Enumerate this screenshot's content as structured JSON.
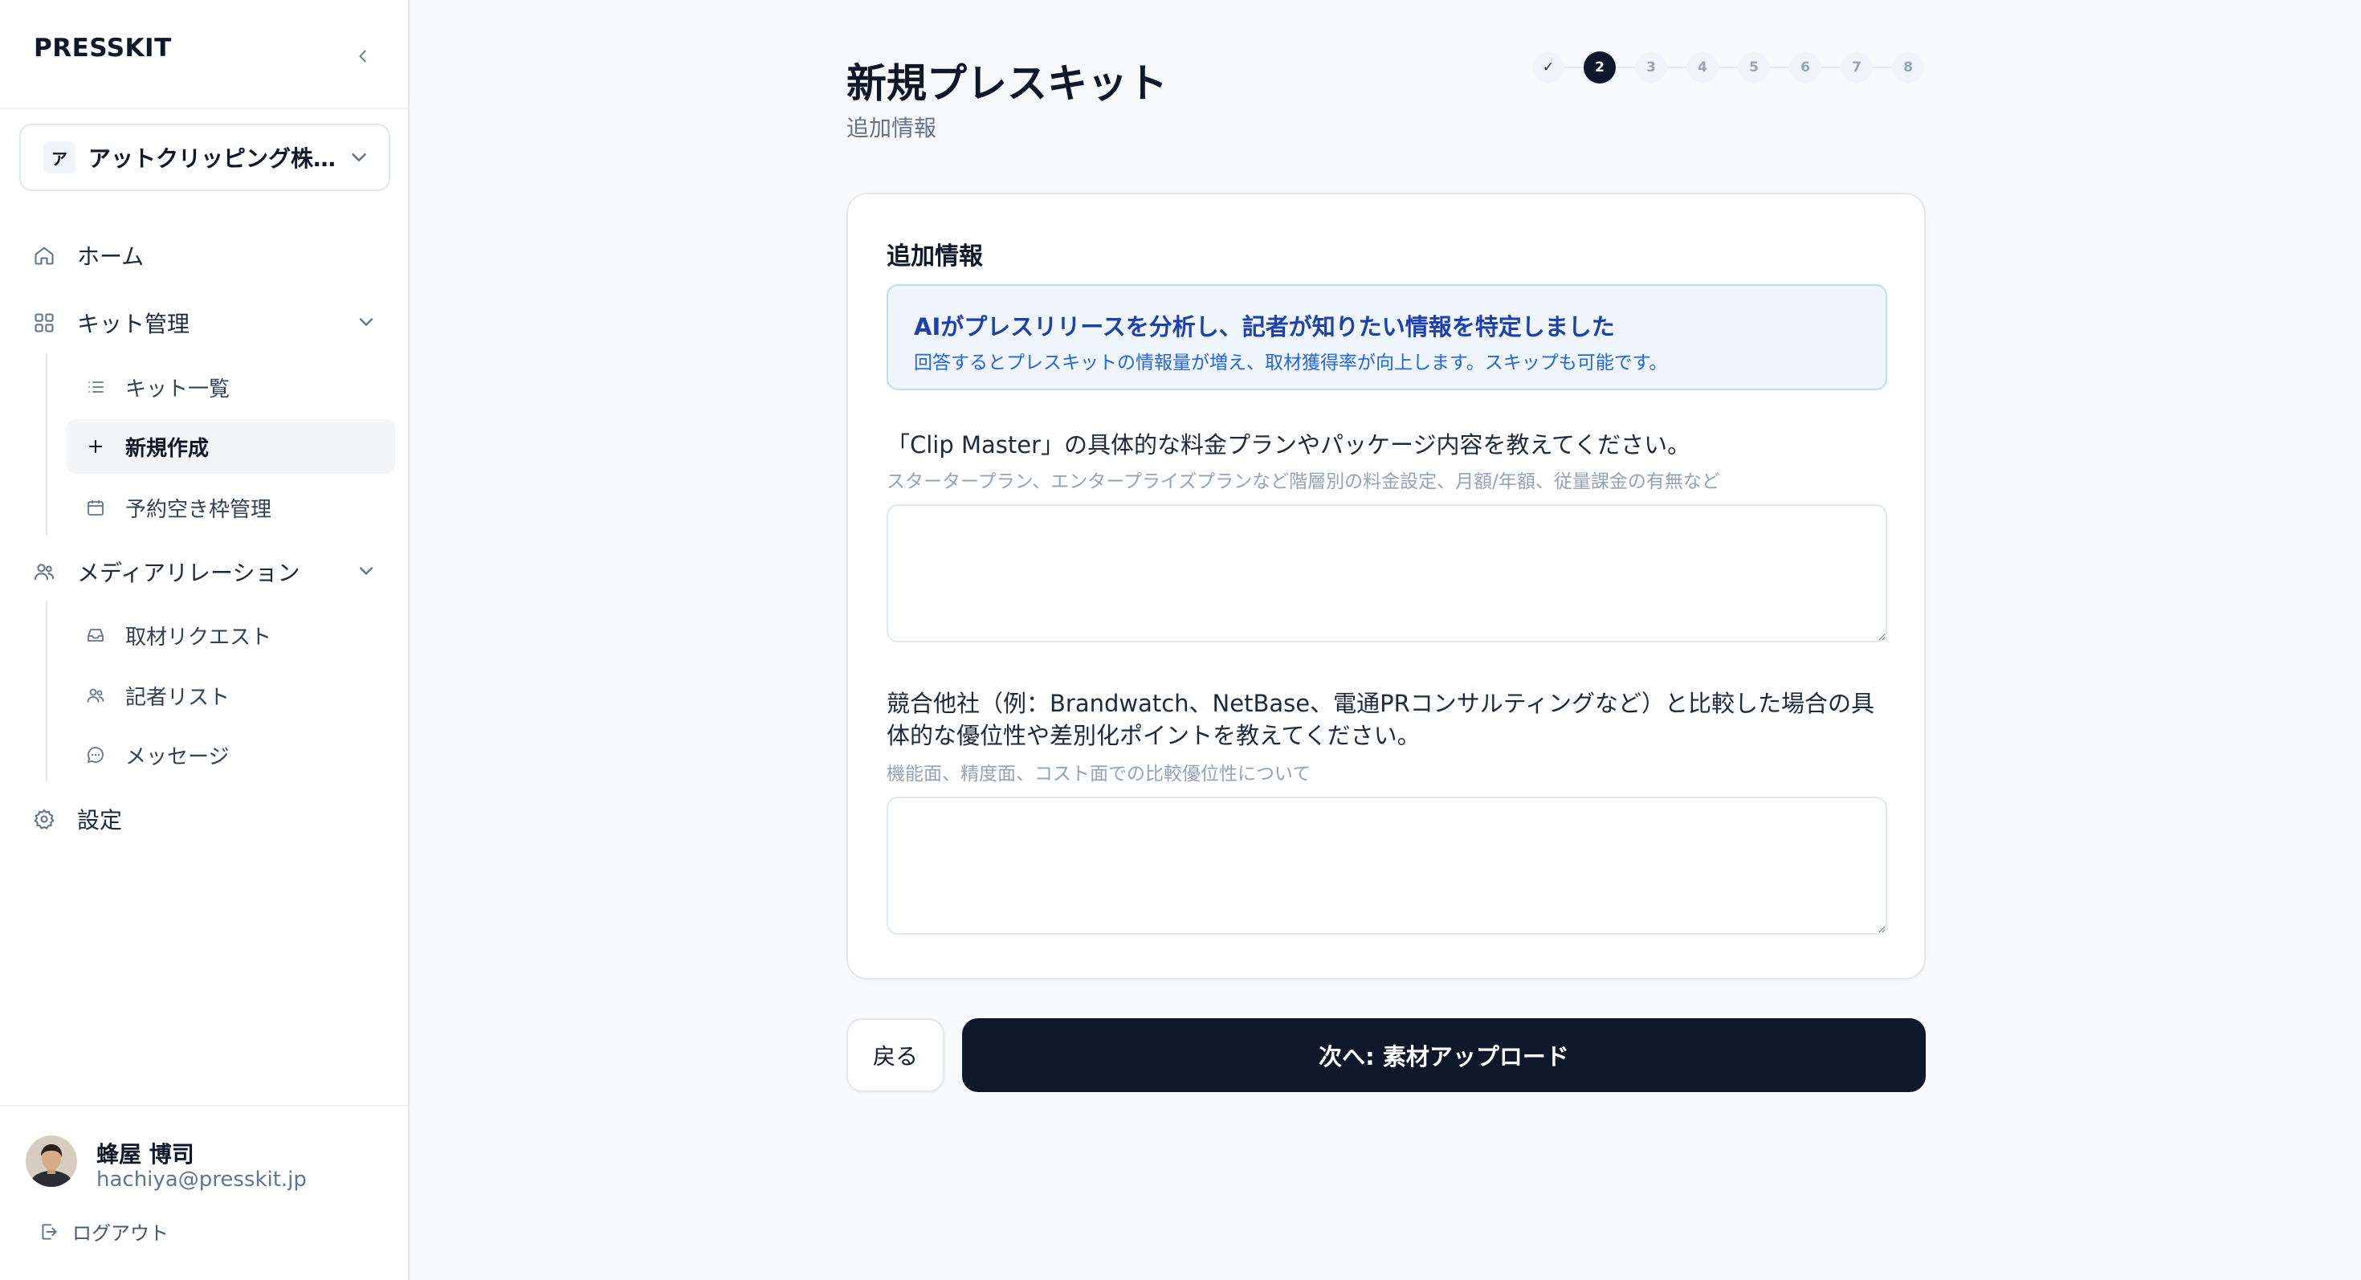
{
  "brand": {
    "logo": "PRESSKIT"
  },
  "org": {
    "avatar_letter": "ア",
    "name": "アットクリッピング株式会社"
  },
  "sidebar": {
    "home": "ホーム",
    "kit_management": "キット管理",
    "kit_list": "キット一覧",
    "new_create": "新規作成",
    "reservation": "予約空き枠管理",
    "media_relations": "メディアリレーション",
    "interview_requests": "取材リクエスト",
    "reporter_list": "記者リスト",
    "messages": "メッセージ",
    "settings": "設定"
  },
  "user": {
    "name": "蜂屋 博司",
    "email": "hachiya@presskit.jp",
    "logout": "ログアウト"
  },
  "header": {
    "title": "新規プレスキット",
    "subtitle": "追加情報"
  },
  "stepper": {
    "done_mark": "✓",
    "current": 2,
    "steps": [
      "2",
      "3",
      "4",
      "5",
      "6",
      "7",
      "8"
    ]
  },
  "card": {
    "title": "追加情報",
    "notice_heading": "AIがプレスリリースを分析し、記者が知りたい情報を特定しました",
    "notice_body": "回答するとプレスキットの情報量が増え、取材獲得率が向上します。スキップも可能です。",
    "questions": [
      {
        "label": "「Clip Master」の具体的な料金プランやパッケージ内容を教えてください。",
        "hint": "スタータープラン、エンタープライズプランなど階層別の料金設定、月額/年額、従量課金の有無など",
        "value": ""
      },
      {
        "label": "競合他社（例：Brandwatch、NetBase、電通PRコンサルティングなど）と比較した場合の具体的な優位性や差別化ポイントを教えてください。",
        "hint": "機能面、精度面、コスト面での比較優位性について",
        "value": ""
      }
    ]
  },
  "actions": {
    "back": "戻る",
    "next": "次へ: 素材アップロード"
  },
  "colors": {
    "primary": "#0f172a",
    "notice_bg": "#eff6ff",
    "notice_text": "#1e40af"
  }
}
